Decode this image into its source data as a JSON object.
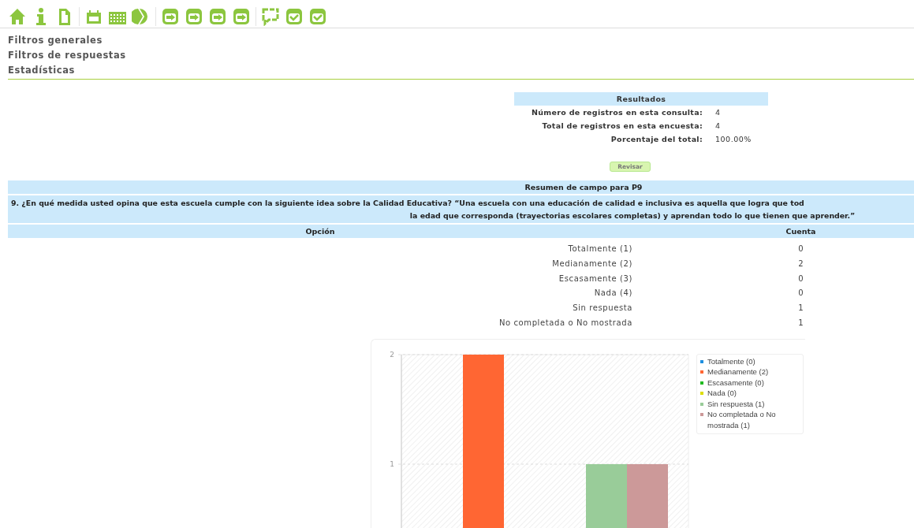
{
  "menu": [
    {
      "label": "Filtros generales"
    },
    {
      "label": "Filtros de respuestas"
    },
    {
      "label": "Estadísticas"
    }
  ],
  "results": {
    "title": "Resultados",
    "rows": [
      {
        "label": "Número de registros en esta consulta:",
        "value": "4"
      },
      {
        "label": "Total de registros en esta encuesta:",
        "value": "4"
      },
      {
        "label": "Porcentaje del total:",
        "value": "100.00%"
      }
    ],
    "button": "Revisar"
  },
  "summary": {
    "title": "Resumen de campo para P9",
    "question_line_1": "9. ¿En qué medida usted opina que esta escuela cumple con la siguiente idea sobre la Calidad Educativa? “Una escuela con una educación de calidad e inclusiva es aquella que logra que tod",
    "question_line_2": "la edad que corresponda (trayectorias escolares completas) y aprendan todo lo que tienen que aprender.”",
    "columns": [
      "Opción",
      "Cuenta"
    ],
    "rows": [
      {
        "option": "Totalmente (1)",
        "count": "0"
      },
      {
        "option": "Medianamente (2)",
        "count": "2"
      },
      {
        "option": "Escasamente (3)",
        "count": "0"
      },
      {
        "option": "Nada (4)",
        "count": "0"
      },
      {
        "option": "Sin respuesta",
        "count": "1"
      },
      {
        "option": "No completada o No mostrada",
        "count": "1"
      }
    ],
    "chart_data": {
      "type": "bar",
      "legend": "right",
      "ylim": [
        0,
        2
      ],
      "yticks": [
        1,
        2
      ],
      "series": [
        {
          "name": "Totalmente (0)",
          "color": "#1e8fe0",
          "values": [
            0
          ]
        },
        {
          "name": "Medianamente (2)",
          "color": "#ff6633",
          "values": [
            2
          ]
        },
        {
          "name": "Escasamente (0)",
          "color": "#22bb22",
          "values": [
            0
          ]
        },
        {
          "name": "Nada (0)",
          "color": "#dddd00",
          "values": [
            0
          ]
        },
        {
          "name": "Sin respuesta (1)",
          "color": "#99cc99",
          "values": [
            1
          ]
        },
        {
          "name": "No completada o No mostrada (1)",
          "color": "#cc9999",
          "values": [
            1
          ]
        }
      ]
    }
  }
}
